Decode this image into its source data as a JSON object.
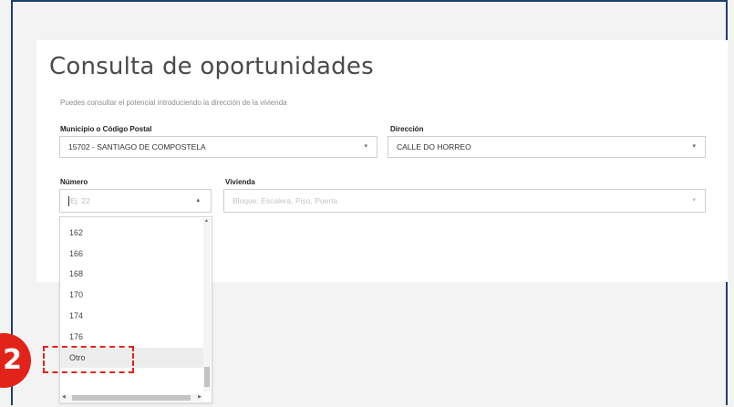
{
  "page": {
    "title": "Consulta de oportunidades",
    "subtitle": "Puedes consultar el potencial introduciendo la dirección de la vivienda"
  },
  "form": {
    "municipio": {
      "label": "Municipio o Código Postal",
      "value": "15702 - SANTIAGO DE COMPOSTELA"
    },
    "direccion": {
      "label": "Dirección",
      "value": "CALLE DO HORREO"
    },
    "numero": {
      "label": "Número",
      "placeholder": "Ej. 22"
    },
    "vivienda": {
      "label": "Vivienda",
      "placeholder": "Bloque, Escalera, Piso, Puerta"
    }
  },
  "dropdown": {
    "options": [
      "162",
      "166",
      "168",
      "170",
      "174",
      "176",
      "Otro"
    ],
    "highlighted": "Otro"
  },
  "annotation": {
    "step_number": "2"
  },
  "colors": {
    "accent_red": "#e2231a",
    "frame_blue": "#1f3e6e"
  },
  "icons": {
    "select_caret": "▾",
    "dropdown_caret_up": "▴"
  }
}
